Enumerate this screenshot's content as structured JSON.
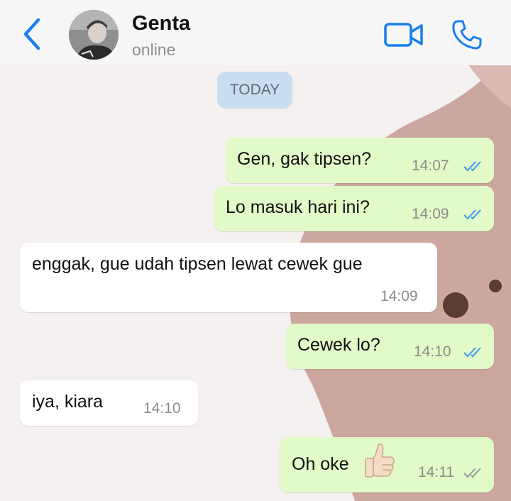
{
  "header": {
    "contact_name": "Genta",
    "status": "online",
    "back_icon": "chevron-left-icon",
    "video_icon": "video-camera-icon",
    "call_icon": "phone-icon",
    "accent": "#1a7ff0"
  },
  "chat": {
    "date_separator": "TODAY",
    "messages": [
      {
        "direction": "outgoing",
        "text": "Gen, gak tipsen?",
        "time": "14:07",
        "read": true
      },
      {
        "direction": "outgoing",
        "text": "Lo masuk hari ini?",
        "time": "14:09",
        "read": true
      },
      {
        "direction": "incoming",
        "text": "enggak, gue udah tipsen lewat cewek gue",
        "time": "14:09"
      },
      {
        "direction": "outgoing",
        "text": "Cewek lo?",
        "time": "14:10",
        "read": true
      },
      {
        "direction": "incoming",
        "text": "iya, kiara",
        "time": "14:10"
      },
      {
        "direction": "outgoing",
        "text": "Oh oke",
        "emoji": "thumbs-up-icon",
        "time": "14:11",
        "read": false
      }
    ]
  },
  "colors": {
    "outgoing_bubble": "#e2f9c8",
    "incoming_bubble": "#ffffff",
    "read_ticks": "#3b9cf0",
    "delivered_ticks": "#9a9a9a"
  }
}
